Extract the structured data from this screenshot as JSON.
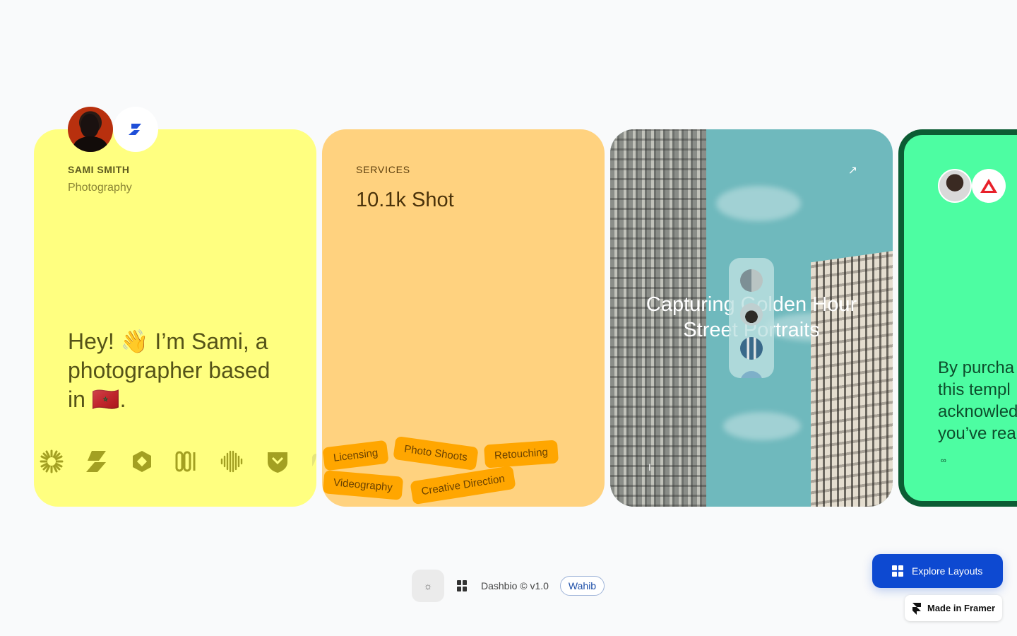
{
  "profile": {
    "name": "SAMI SMITH",
    "role": "Photography",
    "intro": "Hey! 👋 I’m Sami, a photographer based in 🇲🇦."
  },
  "services": {
    "label": "SERVICES",
    "count": "10.1k Shot",
    "tags": [
      "Licensing",
      "Photo Shoots",
      "Retouching",
      "Videography",
      "Creative Direction"
    ]
  },
  "photo_card": {
    "title": "Capturing Golden Hour Street Portraits",
    "arrow": "↗",
    "cursor": "I"
  },
  "terms_card": {
    "text_lines": [
      "By purcha",
      "this templ",
      "acknowled",
      "you’ve rea"
    ],
    "link_glyph": "∞"
  },
  "footer": {
    "theme_icon": "☼",
    "copyright": "Dashbio © v1.0",
    "author": "Wahib"
  },
  "explore_button": {
    "label": "Explore Layouts"
  },
  "framer_badge": {
    "label": "Made in Framer"
  },
  "colors": {
    "profile_card": "#ffff80",
    "services_card": "#ffd27f",
    "terms_card": "#4dfda2",
    "tag": "#ffa600",
    "accent_blue": "#0d49d1"
  }
}
